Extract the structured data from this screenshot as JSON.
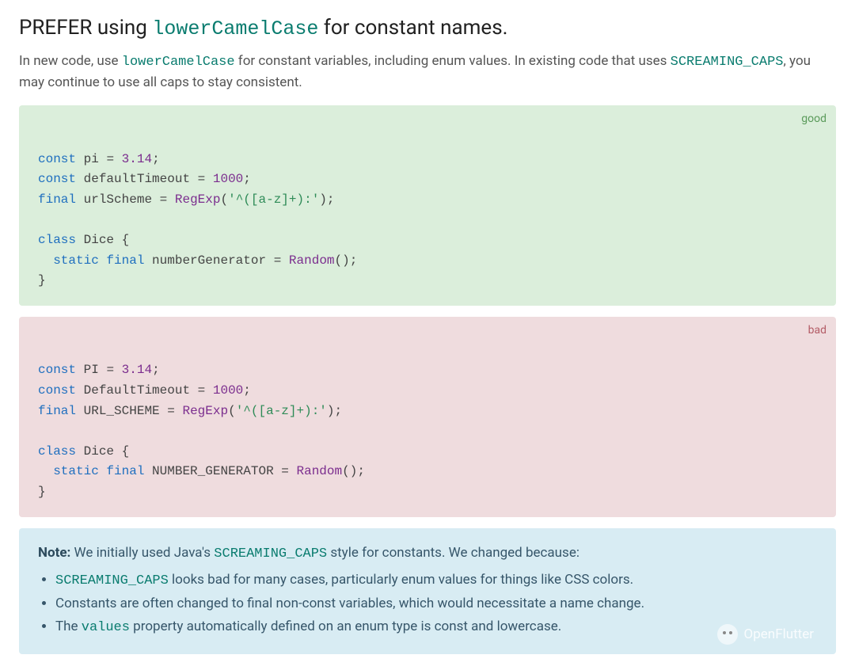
{
  "title_parts": [
    "PREFER using ",
    "lowerCamelCase",
    " for constant names."
  ],
  "lead_parts": [
    "In new code, use ",
    "lowerCamelCase",
    " for constant variables, including enum values. In existing code that uses ",
    "SCREAMING_CAPS",
    ", you may continue to use all caps to stay consistent."
  ],
  "good_label": "good",
  "bad_label": "bad",
  "good_code": {
    "l1": "const pi = 3.14;",
    "l2": "const defaultTimeout = 1000;",
    "l3a": "final urlScheme = ",
    "l3b": "RegExp",
    "l3c": "('^([a-z]+):');",
    "l4": "",
    "l5": "class Dice {",
    "l6a": "  static final numberGenerator = ",
    "l6b": "Random",
    "l6c": "();",
    "l7": "}"
  },
  "bad_code": {
    "l1": "const PI = 3.14;",
    "l2": "const DefaultTimeout = 1000;",
    "l3a": "final URL_SCHEME = ",
    "l3b": "RegExp",
    "l3c": "('^([a-z]+):');",
    "l4": "",
    "l5": "class Dice {",
    "l6a": "  static final NUMBER_GENERATOR = ",
    "l6b": "Random",
    "l6c": "();",
    "l7": "}"
  },
  "note": {
    "label": "Note:",
    "intro_a": " We initially used Java's ",
    "intro_code": "SCREAMING_CAPS",
    "intro_b": " style for constants. We changed because:",
    "li1_code": "SCREAMING_CAPS",
    "li1_rest": " looks bad for many cases, particularly enum values for things like CSS colors.",
    "li2": "Constants are often changed to final non-const variables, which would necessitate a name change.",
    "li3_a": "The ",
    "li3_code": "values",
    "li3_b": " property automatically defined on an enum type is const and lowercase."
  },
  "watermark": "OpenFlutter"
}
